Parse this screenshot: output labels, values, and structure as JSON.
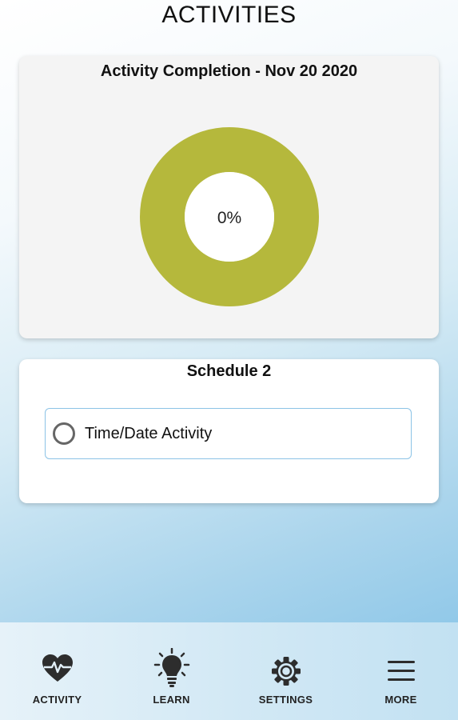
{
  "header": {
    "title": "ACTIVITIES"
  },
  "completion_card": {
    "title": "Activity Completion - Nov 20 2020",
    "percent_label": "0%"
  },
  "chart_data": {
    "type": "pie",
    "title": "Activity Completion - Nov 20 2020",
    "center_label": "0%",
    "slices": [
      {
        "label": "",
        "value": 0,
        "color": "#b5ba3e"
      },
      {
        "label": "",
        "value": 100,
        "color": "#b5b83c"
      }
    ]
  },
  "schedule": {
    "title": "Schedule 2",
    "items": [
      {
        "label": "Time/Date Activity",
        "checked": false
      }
    ]
  },
  "nav": {
    "items": [
      {
        "label": "ACTIVITY",
        "icon": "heartbeat-icon"
      },
      {
        "label": "LEARN",
        "icon": "lightbulb-icon"
      },
      {
        "label": "SETTINGS",
        "icon": "gear-icon"
      },
      {
        "label": "MORE",
        "icon": "menu-icon"
      }
    ]
  },
  "colors": {
    "donut": "#b5b83c",
    "chart_card_bg": "#f4f4f4",
    "item_border": "#8cc3e6"
  }
}
